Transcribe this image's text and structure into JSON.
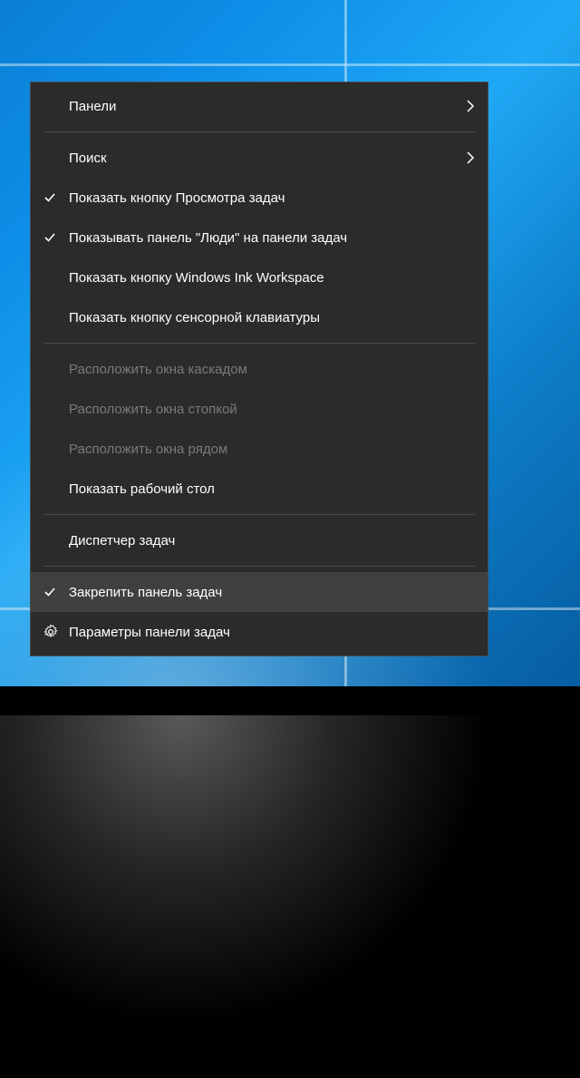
{
  "menu": {
    "panels": "Панели",
    "search": "Поиск",
    "show_task_view": "Показать кнопку Просмотра задач",
    "show_people": "Показывать панель \"Люди\" на панели задач",
    "show_ink": "Показать кнопку Windows Ink Workspace",
    "show_keyboard": "Показать кнопку сенсорной клавиатуры",
    "cascade": "Расположить окна каскадом",
    "stacked": "Расположить окна стопкой",
    "side_by_side": "Расположить окна рядом",
    "show_desktop": "Показать рабочий стол",
    "task_manager": "Диспетчер задач",
    "lock_taskbar": "Закрепить панель задач",
    "taskbar_settings": "Параметры панели задач"
  }
}
